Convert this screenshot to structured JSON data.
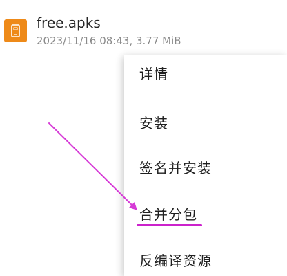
{
  "file": {
    "name": "free.apks",
    "meta": "2023/11/16 08:43, 3.77 MiB",
    "icon": "archive-file-icon",
    "icon_color": "#ee8a19"
  },
  "menu": {
    "items": [
      {
        "label": "详情"
      },
      {
        "label": "安装"
      },
      {
        "label": "签名并安装"
      },
      {
        "label": "合并分包"
      },
      {
        "label": "反编译资源"
      }
    ]
  },
  "annotation": {
    "color": "#cc22cc",
    "highlighted_item": "合并分包"
  }
}
